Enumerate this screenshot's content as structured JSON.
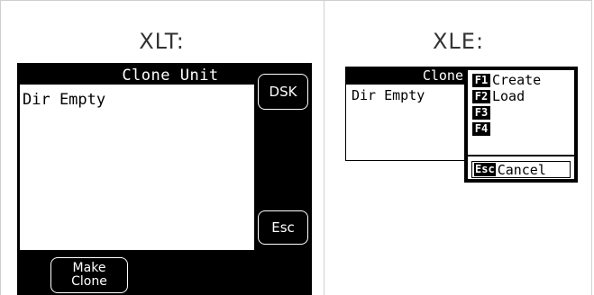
{
  "xlt": {
    "heading": "XLT:",
    "screen_title": "Clone Unit",
    "list_text": "Dir Empty",
    "dsk_button": "DSK",
    "esc_button": "Esc",
    "make_clone_line1": "Make",
    "make_clone_line2": "Clone"
  },
  "xle": {
    "heading": "XLE:",
    "screen_title": "Clone",
    "list_text": "Dir Empty",
    "menu": [
      {
        "key": "F1",
        "label": "Create"
      },
      {
        "key": "F2",
        "label": "Load"
      },
      {
        "key": "F3",
        "label": ""
      },
      {
        "key": "F4",
        "label": ""
      }
    ],
    "cancel_key": "Esc",
    "cancel_label": "Cancel"
  }
}
